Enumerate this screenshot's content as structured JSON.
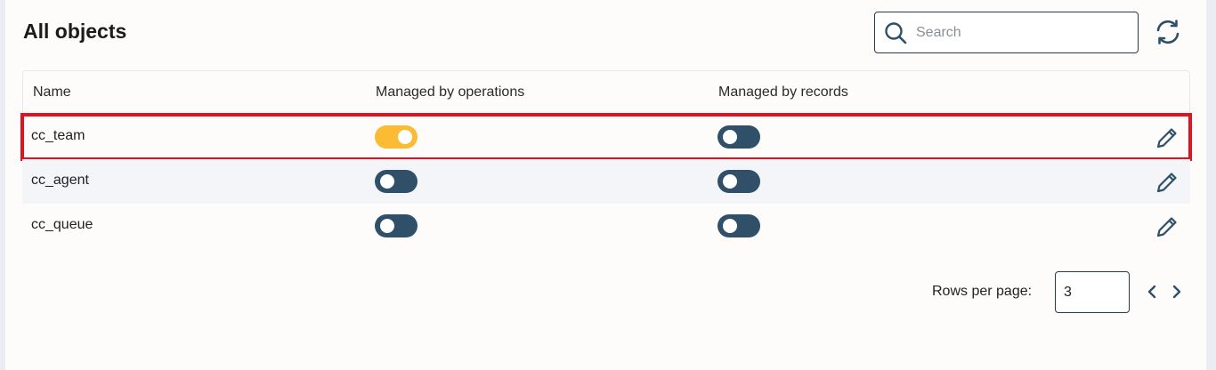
{
  "header": {
    "title": "All objects",
    "search_placeholder": "Search",
    "search_value": ""
  },
  "table": {
    "columns": [
      "Name",
      "Managed by operations",
      "Managed by records"
    ],
    "rows": [
      {
        "name": "cc_team",
        "managed_by_operations": true,
        "managed_by_records": false
      },
      {
        "name": "cc_agent",
        "managed_by_operations": false,
        "managed_by_records": false
      },
      {
        "name": "cc_queue",
        "managed_by_operations": false,
        "managed_by_records": false
      }
    ]
  },
  "pagination": {
    "rows_per_page_label": "Rows per page:",
    "rows_per_page_value": "3"
  },
  "colors": {
    "toggle_on": "#fbbb33",
    "toggle_off": "#2f5068",
    "highlight": "#e0131f",
    "icon": "#2f5068"
  },
  "icons": [
    "search-icon",
    "refresh-icon",
    "pencil-icon",
    "chevron-left-icon",
    "chevron-right-icon"
  ]
}
